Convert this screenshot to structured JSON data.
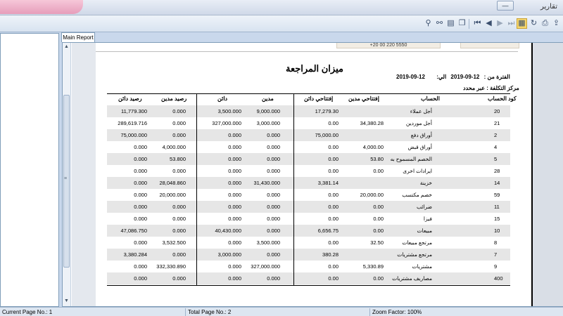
{
  "window": {
    "title": "تقارير"
  },
  "toolbar": {
    "buttons": [
      {
        "icon": "binoculars-icon"
      },
      {
        "icon": "find-next-icon"
      },
      {
        "icon": "page-setup-icon"
      },
      {
        "icon": "copy-icon"
      },
      {
        "icon": "first-page-icon"
      },
      {
        "icon": "prev-page-icon"
      },
      {
        "icon": "next-page-icon"
      },
      {
        "icon": "last-page-icon"
      },
      {
        "icon": "tree-toggle-icon"
      },
      {
        "icon": "refresh-icon"
      },
      {
        "icon": "print-icon"
      },
      {
        "icon": "export-icon"
      }
    ]
  },
  "tabs": {
    "main_report": "Main Report"
  },
  "report": {
    "phone": "+20 00 220 5550",
    "title": "ميزان المراجعة",
    "period_from_label": "الفترة من :",
    "period_from": "12-09-2019",
    "period_to_label": "الي:",
    "period_to": "12-09-2019",
    "cost_center": "مركز التكلفة : عبر محدد",
    "columns": [
      "كود الحساب",
      "الحساب",
      "إفتتاحي مدين",
      "إفتتاحي دائن",
      "مدين",
      "دائن",
      "رصيد مدين",
      "رصيد دائن"
    ],
    "rows": [
      {
        "code": "20",
        "account": "أجل عملاء",
        "open_debit": "",
        "open_credit": "17,279.30",
        "debit": "9,000.000",
        "credit": "3,500.000",
        "bal_debit": "0.000",
        "bal_credit": "11,779.300"
      },
      {
        "code": "21",
        "account": "أجل موردين",
        "open_debit": "34,380.28",
        "open_credit": "0.00",
        "debit": "3,000.000",
        "credit": "327,000.000",
        "bal_debit": "0.000",
        "bal_credit": "289,619.716"
      },
      {
        "code": "2",
        "account": "أوراق دفع",
        "open_debit": "",
        "open_credit": "75,000.00",
        "debit": "0.000",
        "credit": "0.000",
        "bal_debit": "0.000",
        "bal_credit": "75,000.000"
      },
      {
        "code": "4",
        "account": "أوراق قبض",
        "open_debit": "4,000.00",
        "open_credit": "0.00",
        "debit": "0.000",
        "credit": "0.000",
        "bal_debit": "4,000.000",
        "bal_credit": "0.000"
      },
      {
        "code": "5",
        "account": "الخصم المسموح به",
        "open_debit": "53.80",
        "open_credit": "0.00",
        "debit": "0.000",
        "credit": "0.000",
        "bal_debit": "53.800",
        "bal_credit": "0.000"
      },
      {
        "code": "28",
        "account": "ايرادات اخرى",
        "open_debit": "0.00",
        "open_credit": "0.00",
        "debit": "0.000",
        "credit": "0.000",
        "bal_debit": "0.000",
        "bal_credit": "0.000"
      },
      {
        "code": "14",
        "account": "خزينة",
        "open_debit": "",
        "open_credit": "3,381.14",
        "debit": "31,430.000",
        "credit": "0.000",
        "bal_debit": "28,048.860",
        "bal_credit": "0.000"
      },
      {
        "code": "59",
        "account": "خصم مكتسب",
        "open_debit": "20,000.00",
        "open_credit": "0.00",
        "debit": "0.000",
        "credit": "0.000",
        "bal_debit": "20,000.000",
        "bal_credit": "0.000"
      },
      {
        "code": "11",
        "account": "ضرائب",
        "open_debit": "0.00",
        "open_credit": "0.00",
        "debit": "0.000",
        "credit": "0.000",
        "bal_debit": "0.000",
        "bal_credit": "0.000"
      },
      {
        "code": "15",
        "account": "فيزا",
        "open_debit": "0.00",
        "open_credit": "0.00",
        "debit": "0.000",
        "credit": "0.000",
        "bal_debit": "0.000",
        "bal_credit": "0.000"
      },
      {
        "code": "10",
        "account": "مبيعات",
        "open_debit": "0.00",
        "open_credit": "6,656.75",
        "debit": "0.000",
        "credit": "40,430.000",
        "bal_debit": "0.000",
        "bal_credit": "47,086.750"
      },
      {
        "code": "8",
        "account": "مرتجع مبيعات",
        "open_debit": "32.50",
        "open_credit": "0.00",
        "debit": "3,500.000",
        "credit": "0.000",
        "bal_debit": "3,532.500",
        "bal_credit": "0.000"
      },
      {
        "code": "7",
        "account": "مرتجع مشتريات",
        "open_debit": "",
        "open_credit": "380.28",
        "debit": "0.000",
        "credit": "3,000.000",
        "bal_debit": "0.000",
        "bal_credit": "3,380.284"
      },
      {
        "code": "9",
        "account": "مشتريات",
        "open_debit": "5,330.89",
        "open_credit": "0.00",
        "debit": "327,000.000",
        "credit": "0.000",
        "bal_debit": "332,330.890",
        "bal_credit": "0.000"
      },
      {
        "code": "400",
        "account": "مصاريف مشتريات",
        "open_debit": "0.00",
        "open_credit": "0.00",
        "debit": "0.000",
        "credit": "0.000",
        "bal_debit": "0.000",
        "bal_credit": "0.000"
      }
    ]
  },
  "status": {
    "current_page": "Current Page No.: 1",
    "total_pages": "Total Page No.: 2",
    "zoom": "Zoom Factor: 100%"
  }
}
